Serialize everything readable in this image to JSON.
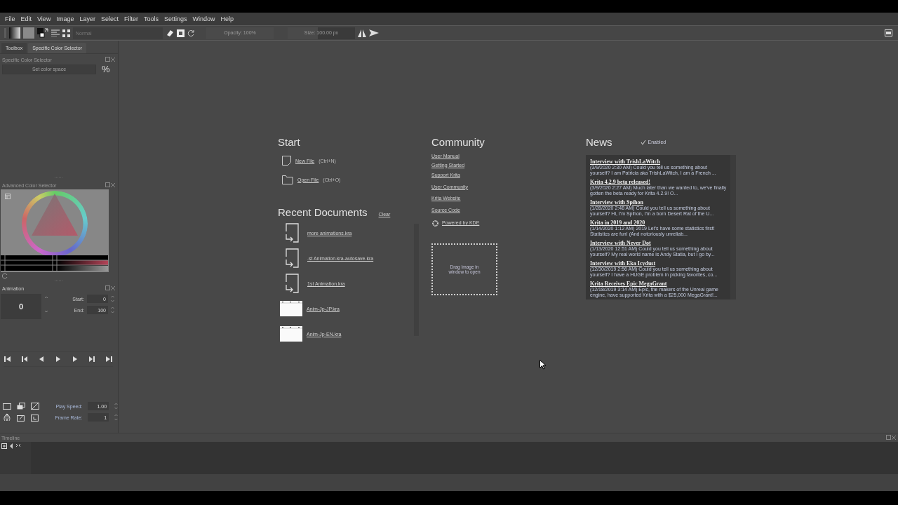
{
  "menu": [
    "File",
    "Edit",
    "View",
    "Image",
    "Layer",
    "Select",
    "Filter",
    "Tools",
    "Settings",
    "Window",
    "Help"
  ],
  "toolbar": {
    "blend_mode": "Normal",
    "opacity": {
      "text": "Opacity: 100%",
      "level": 1
    },
    "size": {
      "text": "Size: 100.00 px",
      "level": 0.45
    }
  },
  "dock_tabs": [
    {
      "label": "Toolbox",
      "selected": false
    },
    {
      "label": "Specific Color Selector",
      "selected": true
    }
  ],
  "specific_color_selector": {
    "title": "Specific Color Selector",
    "color_space_placeholder": "Set color space",
    "percent_button": "%"
  },
  "advanced_color_selector": {
    "title": "Advanced Color Selector"
  },
  "animation": {
    "title": "Animation",
    "current_frame": "0",
    "start_label": "Start:",
    "start": "0",
    "end_label": "End:",
    "end": "100",
    "play_speed_label": "Play Speed:",
    "play_speed": "1.00",
    "frame_rate_label": "Frame Rate:",
    "frame_rate": "1"
  },
  "welcome": {
    "start": {
      "title": "Start",
      "actions": [
        {
          "kind": "new",
          "label": "New File",
          "shortcut": "(Ctrl+N)"
        },
        {
          "kind": "open",
          "label": "Open File",
          "shortcut": "(Ctrl+O)"
        }
      ]
    },
    "recent": {
      "title": "Recent Documents",
      "clear": "Clear",
      "items": [
        {
          "kind": "generic",
          "name": "more animations.kra"
        },
        {
          "kind": "generic",
          "name": ".st Animation.kra-autosave.kra"
        },
        {
          "kind": "generic",
          "name": "1st Animation.kra"
        },
        {
          "kind": "thumbnail",
          "name": "Anim-Jp-JP.kra"
        },
        {
          "kind": "thumbnail",
          "name": "Anim-Jp-EN.kra"
        }
      ]
    },
    "community": {
      "title": "Community",
      "links": [
        "User Manual",
        "Getting Started",
        "Support Krita",
        "User Community",
        "Krita Website",
        "Source Code"
      ],
      "kde_link": "Powered by KDE"
    },
    "drop_zone": "Drag Image in window to open",
    "news": {
      "title": "News",
      "enabled_label": "Enabled",
      "enabled": true,
      "items": [
        {
          "title": "Interview with TrishLaWitch",
          "summary": "(3/9/2020 2:30 AM) Could you tell us something about yourself? I am Patricia aka TrishLaWitch, I am a French ..."
        },
        {
          "title": "Krita 4.2.9 beta released!",
          "summary": "(3/9/2020 2:27 AM) Much later than we wanted to, we've finally gotten the beta ready for Krita 4.2.9! O..."
        },
        {
          "title": "Interview with Spihon",
          "summary": "(1/28/2020 2:48 AM) Could you tell us something about yourself? Hi, I'm Spihon, I'm a born Desert Rat of the U..."
        },
        {
          "title": "Krita in 2019 and 2020",
          "summary": "(1/14/2020 1:12 AM) 2019 Let's have some statistics first! Statistics are fun! (And notoriously unreliab..."
        },
        {
          "title": "Interview with Never Dot",
          "summary": "(1/13/2020 12:51 AM) Could you tell us something about yourself? My real world name is Andy Statia, but I go by..."
        },
        {
          "title": "Interview with Eka Icydust",
          "summary": "(12/30/2019 2:56 AM) Could you tell us something about yourself? I have a HUGE problem in picking favorites, co..."
        },
        {
          "title": "Krita Receives Epic MegaGrant",
          "summary": "(12/18/2019 3:14 AM) Epic, the makers of the Unreal game engine, have supported Krita with a $25,000 MegaGrant!..."
        }
      ]
    }
  },
  "timeline": {
    "title": "Timeline"
  }
}
